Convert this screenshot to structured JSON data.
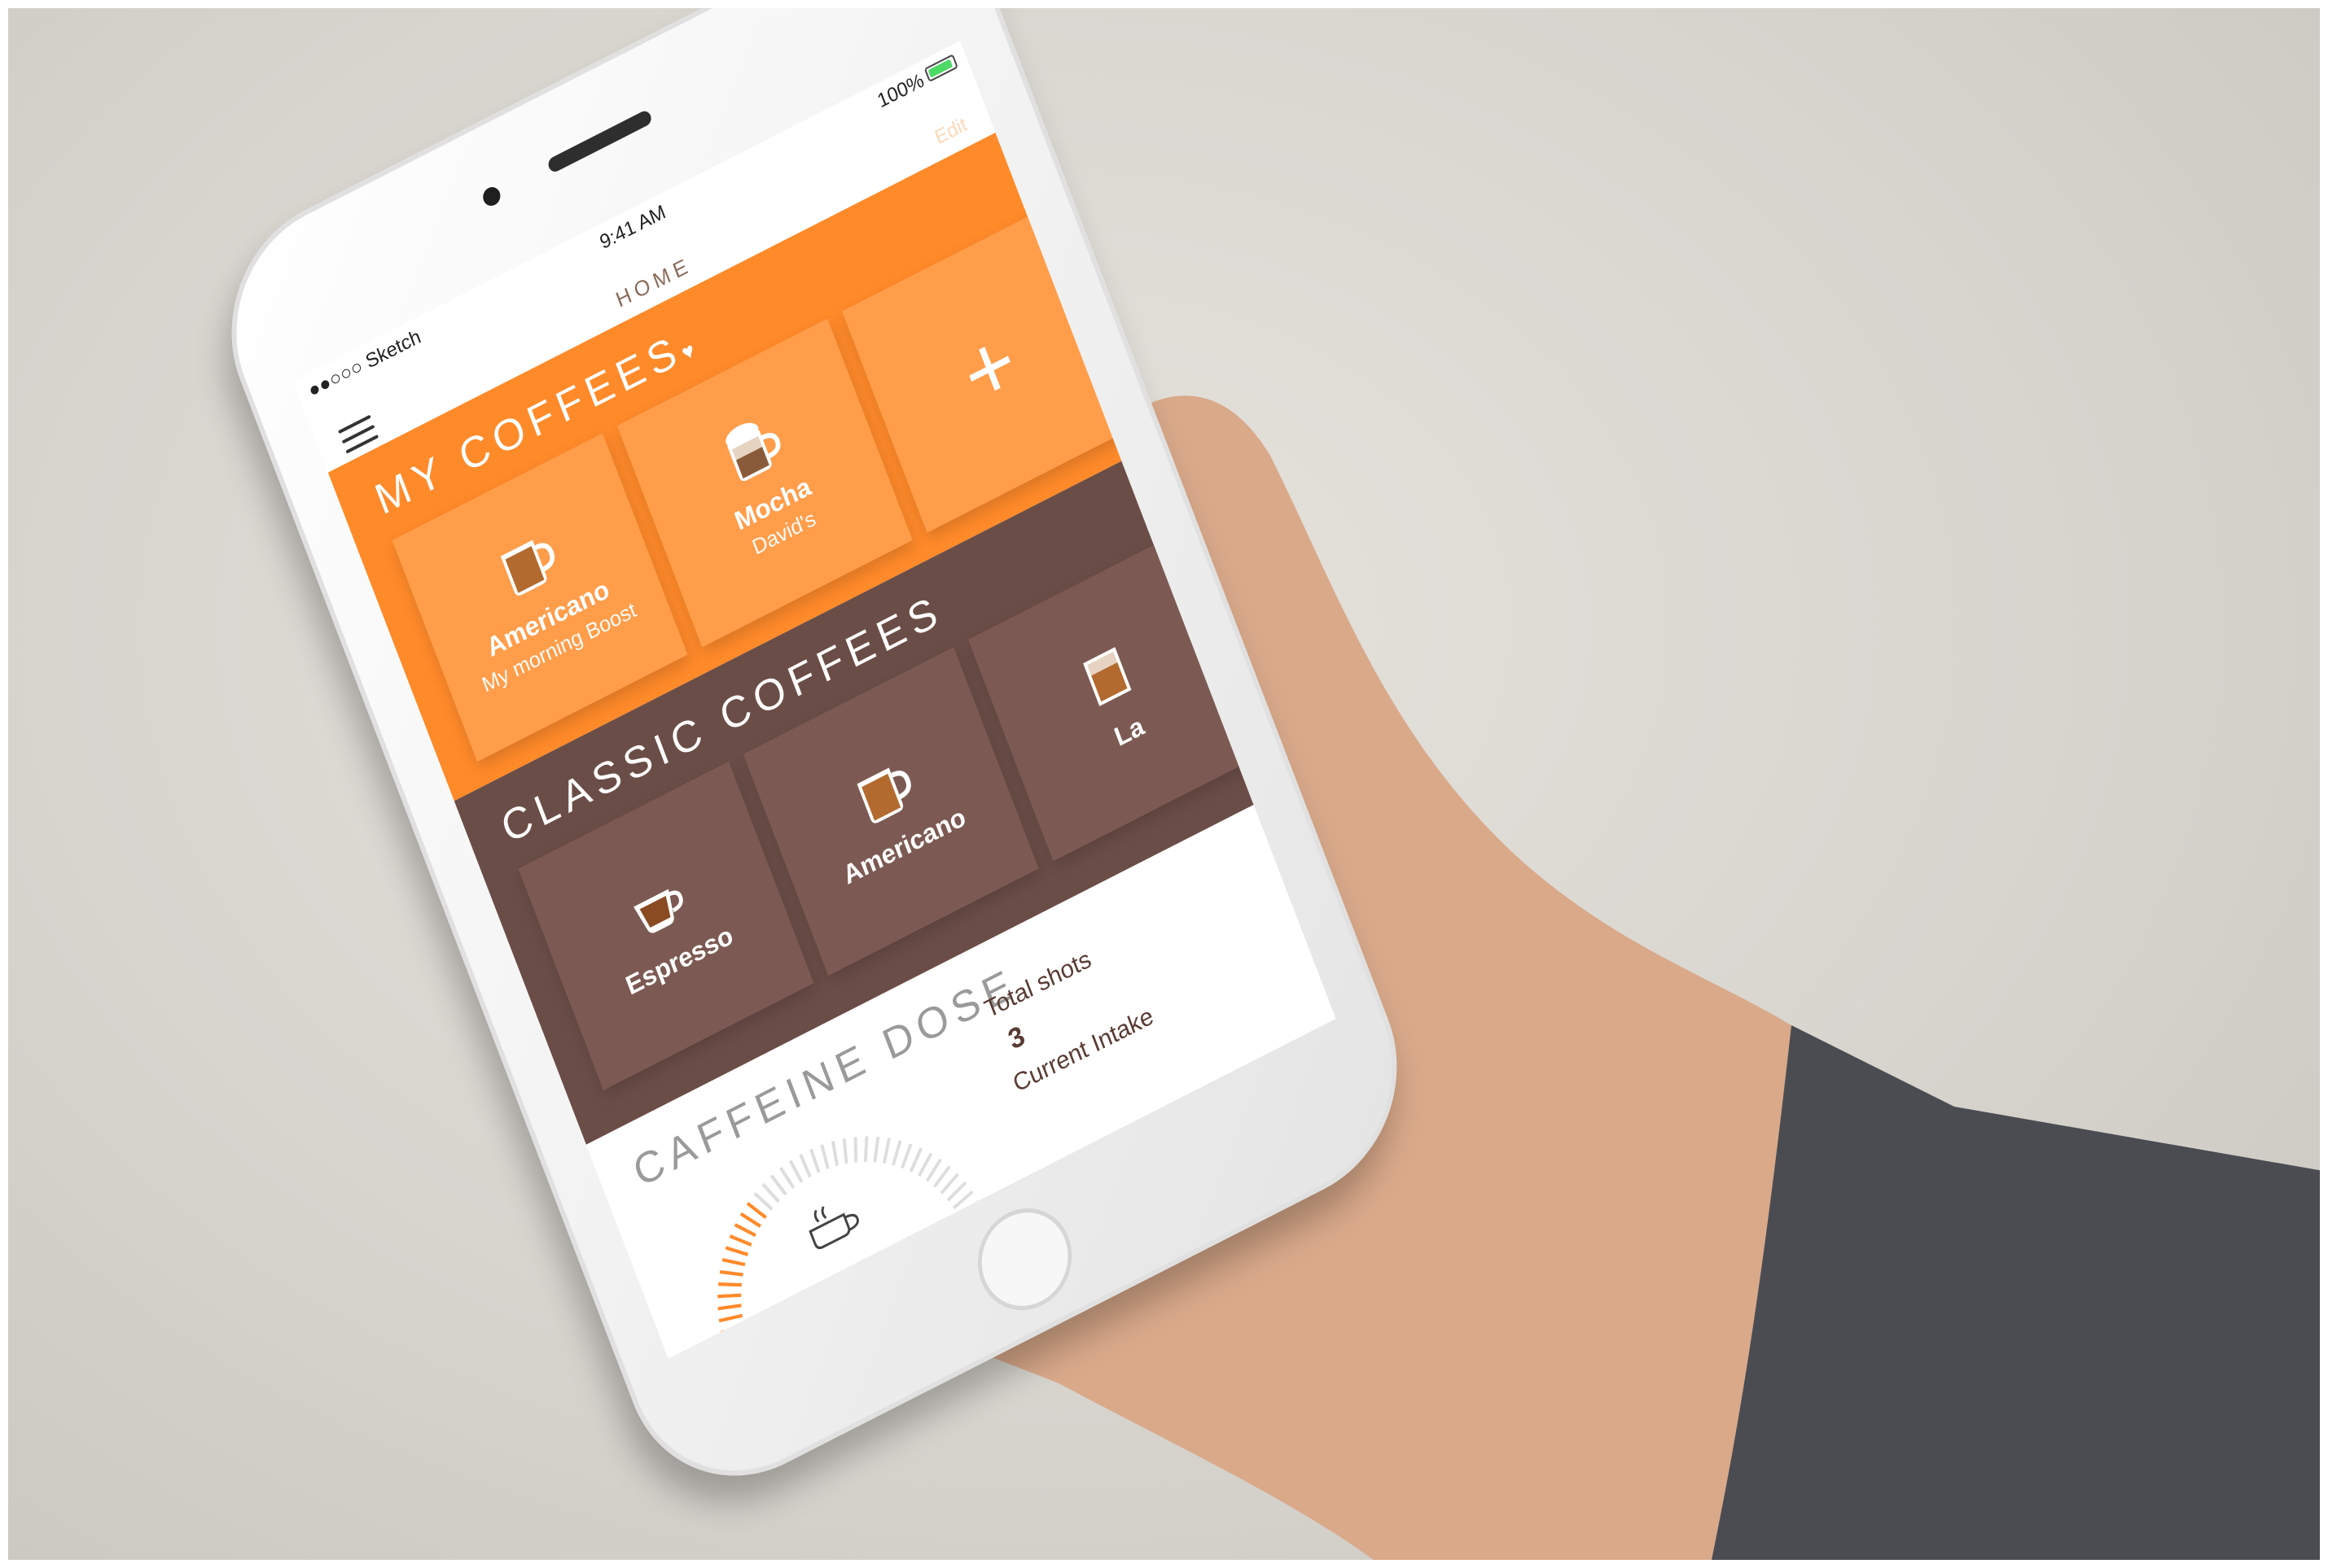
{
  "status_bar": {
    "carrier": "●●○○○ Sketch",
    "time": "9:41 AM",
    "battery": "100%"
  },
  "nav": {
    "title": "HOME",
    "edit_label": "Edit"
  },
  "my_coffees": {
    "title": "MY COFFEES",
    "items": [
      {
        "title": "Americano",
        "subtitle": "My morning Boost",
        "icon": "coffee-mug-icon"
      },
      {
        "title": "Mocha",
        "subtitle": "David's",
        "icon": "mocha-cup-icon"
      }
    ],
    "add_icon": "plus-icon"
  },
  "classic_coffees": {
    "title": "CLASSIC COFFEES",
    "items": [
      {
        "title": "Espresso",
        "icon": "espresso-cup-icon"
      },
      {
        "title": "Americano",
        "icon": "coffee-mug-icon"
      },
      {
        "title": "La",
        "icon": "coffee-glass-icon"
      }
    ]
  },
  "caffeine": {
    "title": "CAFFEINE DOSE",
    "total_shots_label": "Total shots",
    "total_shots_value": "3",
    "current_intake_label": "Current Intake",
    "gauge_fraction": 0.35
  },
  "colors": {
    "orange": "#ff8a2a",
    "orange_light": "#ff9d4a",
    "brown": "#6b4d47",
    "brown_light": "#7c5a53",
    "green_battery": "#4cd964"
  }
}
